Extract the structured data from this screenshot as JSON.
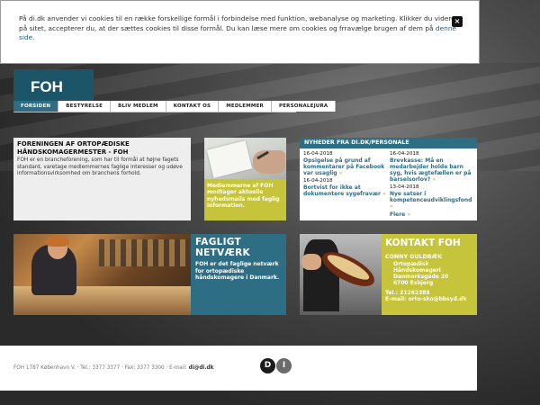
{
  "cookie": {
    "text_before_link": "På di.dk anvender vi cookies til en række forskellige formål i forbindelse med funktion, webanalyse og marketing. Klikker du videre på sitet, accepterer du, at der sættes cookies til disse formål. Du kan læse mere om cookies og frravælge brugen af dem på ",
    "link": "denne side",
    "text_after_link": ".",
    "close": "×"
  },
  "logo": "FOH",
  "nav": [
    "FORSIDEN",
    "BESTYRELSE",
    "BLIV MEDLEM",
    "KONTAKT OS",
    "MEDLEMMER",
    "PERSONALEJURA"
  ],
  "intro": {
    "title": "FORENINGEN AF ORTOPÆDISKE HÅNDSKOMAGERMESTER - FOH",
    "body": "FOH er en brancheforening, som har til formål at højne fagets standard, varetage medlemmernes faglige interesser og udøve informationsvirksomhed om branchens forhold."
  },
  "promo": {
    "text": "Medlemmerne af FOH modtager aktuelle nyhedsmails med faglig information."
  },
  "news": {
    "heading": "NYHEDER FRA DI.DK/PERSONALE",
    "col1": [
      {
        "date": "16-04-2018",
        "title": "Opsigelse på grund af kommentarer på Facebook var usaglig"
      },
      {
        "date": "16-04-2018",
        "title": "Bortvist for ikke at dokumentere sygefravær"
      }
    ],
    "col2": [
      {
        "date": "16-04-2018",
        "title": "Brevkasse: Må en medarbejder holde barn syg, hvis ægtefællen er på barselsorlov?"
      },
      {
        "date": "13-04-2018",
        "title": "Nye satser i kompetenceudviklingsfond"
      }
    ],
    "more": "Flere"
  },
  "fagligt": {
    "title": "FAGLIGT NETVÆRK",
    "body": "FOH er det faglige netværk for ortopædiske håndskomagere i Danmark."
  },
  "kontakt": {
    "title": "KONTAKT FOH",
    "name": "CONNY GULDBÆK",
    "lines": [
      "Ortopædisk",
      "Håndskomageri",
      "Danmarksgade 20",
      "6700 Esbjerg"
    ],
    "tel": "Tel.: 21262388",
    "email": "E-mail: orto-sko@bbsyd.dk"
  },
  "footer": {
    "address": "FOH 1787 København V.  ·  Tel.: 3377 3377  ·  Fax: 3377 3300  ·  E-mail: ",
    "email": "di@di.dk",
    "di_d": "D",
    "di_i": "I"
  }
}
